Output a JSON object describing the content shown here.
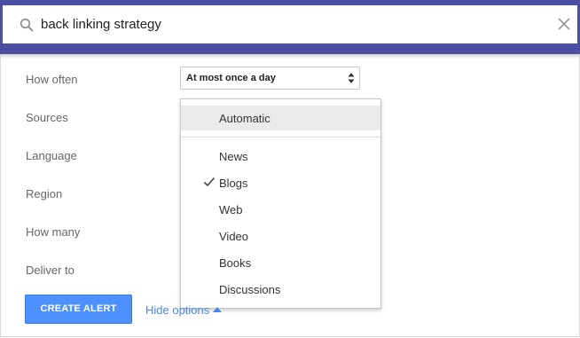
{
  "search": {
    "query": "back linking strategy",
    "icon": "search-icon",
    "close_icon": "close-icon"
  },
  "form": {
    "labels": [
      "How often",
      "Sources",
      "Language",
      "Region",
      "How many",
      "Deliver to"
    ],
    "how_often_value": "At most once a day"
  },
  "dropdown": {
    "items": [
      {
        "label": "Automatic",
        "highlighted": true,
        "checked": false
      },
      {
        "label": "News",
        "highlighted": false,
        "checked": false
      },
      {
        "label": "Blogs",
        "highlighted": false,
        "checked": true
      },
      {
        "label": "Web",
        "highlighted": false,
        "checked": false
      },
      {
        "label": "Video",
        "highlighted": false,
        "checked": false
      },
      {
        "label": "Books",
        "highlighted": false,
        "checked": false
      },
      {
        "label": "Discussions",
        "highlighted": false,
        "checked": false
      }
    ]
  },
  "actions": {
    "create_label": "CREATE ALERT",
    "hide_options_label": "Hide options"
  },
  "colors": {
    "header": "#4a4fa3",
    "button": "#4d90fe",
    "link": "#4a86e8"
  }
}
